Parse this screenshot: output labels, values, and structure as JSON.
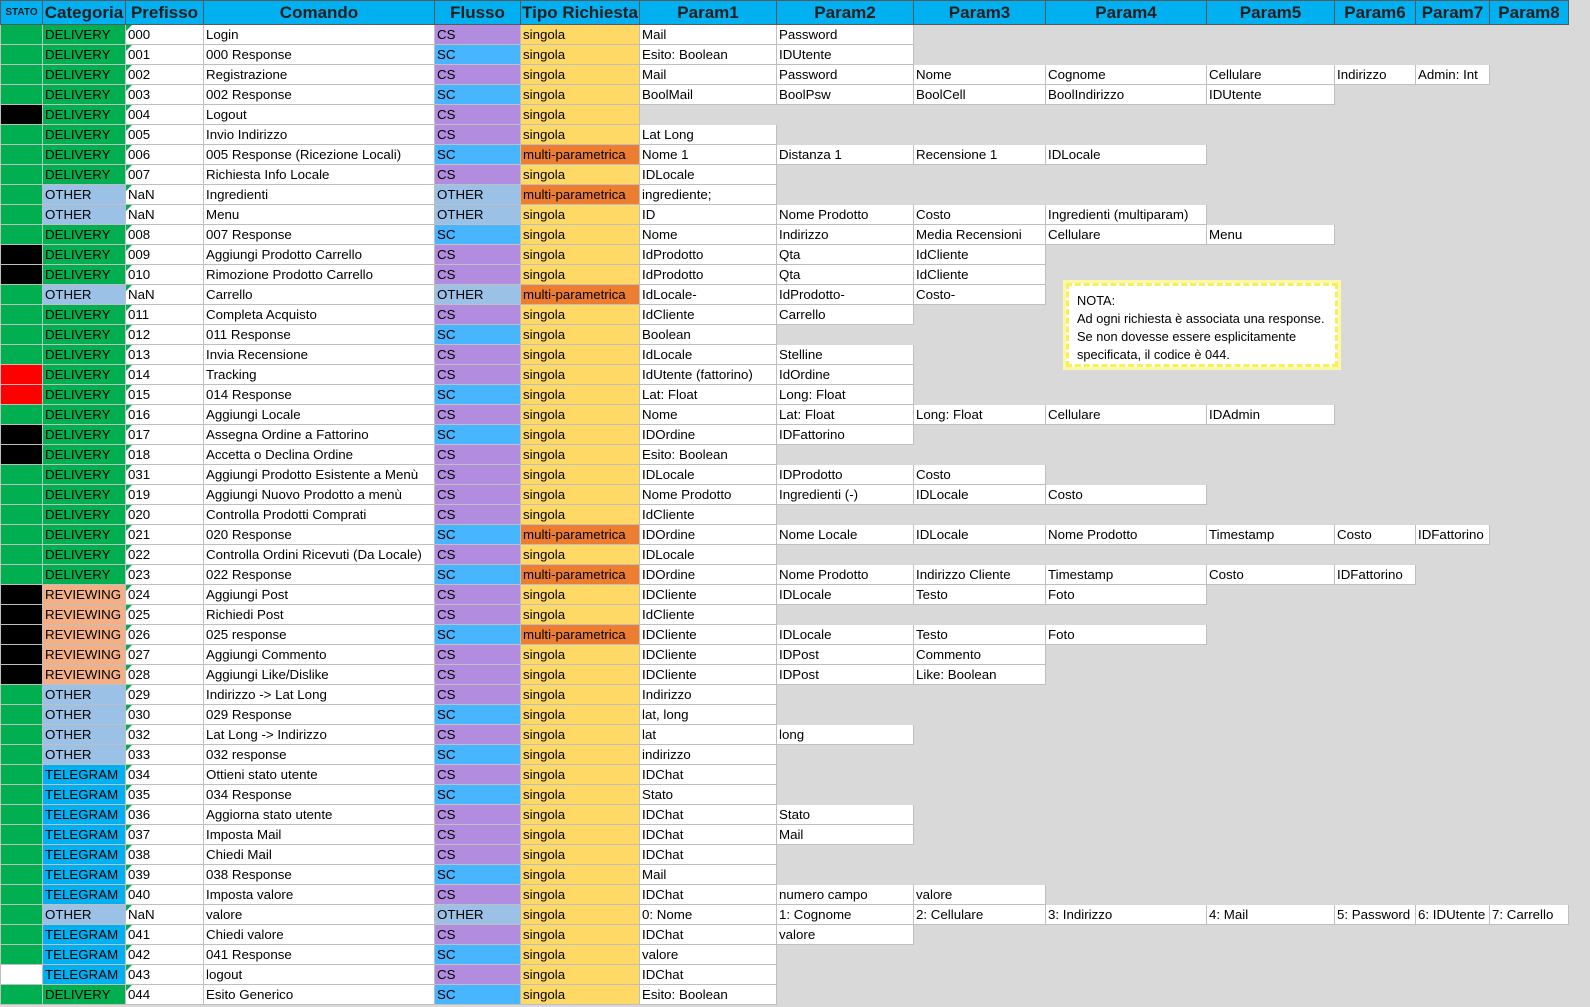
{
  "headers": [
    "STATO",
    "Categoria",
    "Prefisso",
    "Comando",
    "Flusso",
    "Tipo Richiesta",
    "Param1",
    "Param2",
    "Param3",
    "Param4",
    "Param5",
    "Param6",
    "Param7",
    "Param8"
  ],
  "colors": {
    "stato_green": "#00b050",
    "stato_black": "#000000",
    "stato_red": "#ff0000",
    "stato_white": "#ffffff",
    "header_bg": "#00b0f0"
  },
  "note": "NOTA:\nAd ogni richiesta è associata una response.\nSe non dovesse essere esplicitamente specificata, il codice è 044.",
  "rows": [
    {
      "stato": "green",
      "cat": "DELIVERY",
      "pref": "000",
      "cmd": "Login",
      "flusso": "CS",
      "tipo": "singola",
      "params": [
        "Mail",
        "Password"
      ]
    },
    {
      "stato": "green",
      "cat": "DELIVERY",
      "pref": "001",
      "cmd": "000 Response",
      "flusso": "SC",
      "tipo": "singola",
      "params": [
        "Esito: Boolean",
        "IDUtente"
      ]
    },
    {
      "stato": "green",
      "cat": "DELIVERY",
      "pref": "002",
      "cmd": "Registrazione",
      "flusso": "CS",
      "tipo": "singola",
      "params": [
        "Mail",
        "Password",
        "Nome",
        "Cognome",
        "Cellulare",
        "Indirizzo",
        "Admin: Int"
      ]
    },
    {
      "stato": "green",
      "cat": "DELIVERY",
      "pref": "003",
      "cmd": "002 Response",
      "flusso": "SC",
      "tipo": "singola",
      "params": [
        "BoolMail",
        "BoolPsw",
        "BoolCell",
        "BoolIndirizzo",
        "IDUtente"
      ]
    },
    {
      "stato": "black",
      "cat": "DELIVERY",
      "pref": "004",
      "cmd": "Logout",
      "flusso": "CS",
      "tipo": "singola",
      "params": []
    },
    {
      "stato": "green",
      "cat": "DELIVERY",
      "pref": "005",
      "cmd": "Invio Indirizzo",
      "flusso": "CS",
      "tipo": "singola",
      "params": [
        "Lat Long"
      ]
    },
    {
      "stato": "green",
      "cat": "DELIVERY",
      "pref": "006",
      "cmd": "005 Response (Ricezione Locali)",
      "flusso": "SC",
      "tipo": "multi-parametrica",
      "params": [
        " Nome 1",
        "Distanza 1",
        "Recensione 1",
        "IDLocale"
      ]
    },
    {
      "stato": "green",
      "cat": "DELIVERY",
      "pref": "007",
      "cmd": "Richiesta Info Locale",
      "flusso": "CS",
      "tipo": "singola",
      "params": [
        "IDLocale"
      ]
    },
    {
      "stato": "green",
      "cat": "OTHER",
      "pref": "NaN",
      "cmd": "Ingredienti",
      "flusso": "OTHER",
      "tipo": "multi-parametrica",
      "params": [
        "ingrediente;"
      ]
    },
    {
      "stato": "green",
      "cat": "OTHER",
      "pref": "NaN",
      "cmd": "Menu",
      "flusso": "OTHER",
      "tipo": "singola",
      "params": [
        "ID",
        "Nome Prodotto",
        "Costo",
        "Ingredienti (multiparam)"
      ]
    },
    {
      "stato": "green",
      "cat": "DELIVERY",
      "pref": "008",
      "cmd": "007 Response",
      "flusso": "SC",
      "tipo": "singola",
      "params": [
        "Nome",
        "Indirizzo",
        "Media Recensioni",
        "Cellulare",
        "Menu"
      ]
    },
    {
      "stato": "black",
      "cat": "DELIVERY",
      "pref": "009",
      "cmd": "Aggiungi Prodotto Carrello",
      "flusso": "CS",
      "tipo": "singola",
      "params": [
        "IdProdotto",
        "Qta",
        "IdCliente"
      ]
    },
    {
      "stato": "black",
      "cat": "DELIVERY",
      "pref": "010",
      "cmd": "Rimozione Prodotto Carrello",
      "flusso": "CS",
      "tipo": "singola",
      "params": [
        "IdProdotto",
        "Qta",
        "IdCliente"
      ]
    },
    {
      "stato": "green",
      "cat": "OTHER",
      "pref": "NaN",
      "cmd": "Carrello",
      "flusso": "OTHER",
      "tipo": "multi-parametrica",
      "params": [
        "IdLocale-",
        "IdProdotto-",
        "Costo-"
      ]
    },
    {
      "stato": "green",
      "cat": "DELIVERY",
      "pref": "011",
      "cmd": "Completa Acquisto",
      "flusso": "CS",
      "tipo": "singola",
      "params": [
        "IdCliente",
        "Carrello"
      ]
    },
    {
      "stato": "green",
      "cat": "DELIVERY",
      "pref": "012",
      "cmd": "011 Response",
      "flusso": "SC",
      "tipo": "singola",
      "params": [
        "Boolean"
      ]
    },
    {
      "stato": "green",
      "cat": "DELIVERY",
      "pref": "013",
      "cmd": "Invia Recensione",
      "flusso": "CS",
      "tipo": "singola",
      "params": [
        "IdLocale",
        "Stelline"
      ]
    },
    {
      "stato": "red",
      "cat": "DELIVERY",
      "pref": "014",
      "cmd": "Tracking",
      "flusso": "CS",
      "tipo": "singola",
      "params": [
        "IdUtente (fattorino)",
        "IdOrdine"
      ]
    },
    {
      "stato": "red",
      "cat": "DELIVERY",
      "pref": "015",
      "cmd": "014 Response",
      "flusso": "SC",
      "tipo": "singola",
      "params": [
        "Lat: Float",
        "Long: Float"
      ]
    },
    {
      "stato": "green",
      "cat": "DELIVERY",
      "pref": "016",
      "cmd": "Aggiungi Locale",
      "flusso": "CS",
      "tipo": "singola",
      "params": [
        "Nome",
        "Lat: Float",
        "Long: Float",
        "Cellulare",
        "IDAdmin"
      ]
    },
    {
      "stato": "black",
      "cat": "DELIVERY",
      "pref": "017",
      "cmd": "Assegna Ordine a Fattorino",
      "flusso": "SC",
      "tipo": "singola",
      "params": [
        "IDOrdine",
        "IDFattorino"
      ]
    },
    {
      "stato": "black",
      "cat": "DELIVERY",
      "pref": "018",
      "cmd": "Accetta o Declina Ordine",
      "flusso": "CS",
      "tipo": "singola",
      "params": [
        "Esito: Boolean"
      ]
    },
    {
      "stato": "green",
      "cat": "DELIVERY",
      "pref": "031",
      "cmd": "Aggiungi Prodotto Esistente a Menù",
      "flusso": "CS",
      "tipo": "singola",
      "params": [
        "IDLocale",
        "IDProdotto",
        "Costo"
      ]
    },
    {
      "stato": "green",
      "cat": "DELIVERY",
      "pref": "019",
      "cmd": "Aggiungi Nuovo Prodotto a menù",
      "flusso": "CS",
      "tipo": "singola",
      "params": [
        "Nome Prodotto",
        "Ingredienti (-)",
        "IDLocale",
        "Costo"
      ]
    },
    {
      "stato": "green",
      "cat": "DELIVERY",
      "pref": "020",
      "cmd": "Controlla Prodotti Comprati",
      "flusso": "CS",
      "tipo": "singola",
      "params": [
        "IdCliente"
      ]
    },
    {
      "stato": "green",
      "cat": "DELIVERY",
      "pref": "021",
      "cmd": "020 Response",
      "flusso": "SC",
      "tipo": "multi-parametrica",
      "params": [
        "IDOrdine",
        "Nome Locale",
        "IDLocale",
        "Nome Prodotto",
        "Timestamp",
        "Costo",
        "IDFattorino"
      ]
    },
    {
      "stato": "green",
      "cat": "DELIVERY",
      "pref": "022",
      "cmd": "Controlla Ordini Ricevuti (Da Locale)",
      "flusso": "CS",
      "tipo": "singola",
      "params": [
        "IDLocale"
      ]
    },
    {
      "stato": "green",
      "cat": "DELIVERY",
      "pref": "023",
      "cmd": "022 Response",
      "flusso": "SC",
      "tipo": "multi-parametrica",
      "params": [
        "IDOrdine",
        "Nome Prodotto",
        "Indirizzo Cliente",
        "Timestamp",
        "Costo",
        "IDFattorino"
      ]
    },
    {
      "stato": "black",
      "cat": "REVIEWING",
      "pref": "024",
      "cmd": "Aggiungi Post",
      "flusso": "CS",
      "tipo": "singola",
      "params": [
        "IDCliente",
        "IDLocale",
        "Testo",
        "Foto"
      ]
    },
    {
      "stato": "black",
      "cat": "REVIEWING",
      "pref": "025",
      "cmd": "Richiedi Post",
      "flusso": "CS",
      "tipo": "singola",
      "params": [
        "IdCliente"
      ]
    },
    {
      "stato": "black",
      "cat": "REVIEWING",
      "pref": "026",
      "cmd": "025 response",
      "flusso": "SC",
      "tipo": "multi-parametrica",
      "params": [
        "IDCliente",
        "IDLocale",
        "Testo",
        "Foto"
      ]
    },
    {
      "stato": "black",
      "cat": "REVIEWING",
      "pref": "027",
      "cmd": "Aggiungi Commento",
      "flusso": "CS",
      "tipo": "singola",
      "params": [
        "IDCliente",
        "IDPost",
        "Commento"
      ]
    },
    {
      "stato": "black",
      "cat": "REVIEWING",
      "pref": "028",
      "cmd": "Aggiungi Like/Dislike",
      "flusso": "CS",
      "tipo": "singola",
      "params": [
        "IDCliente",
        "IDPost",
        "Like: Boolean"
      ]
    },
    {
      "stato": "green",
      "cat": "OTHER",
      "pref": "029",
      "cmd": "Indirizzo -> Lat Long",
      "flusso": "CS",
      "tipo": "singola",
      "params": [
        "Indirizzo"
      ]
    },
    {
      "stato": "green",
      "cat": "OTHER",
      "pref": "030",
      "cmd": "029 Response",
      "flusso": "SC",
      "tipo": "singola",
      "params": [
        "lat, long"
      ]
    },
    {
      "stato": "green",
      "cat": "OTHER",
      "pref": "032",
      "cmd": "Lat Long -> Indirizzo",
      "flusso": "CS",
      "tipo": "singola",
      "params": [
        "lat",
        "long"
      ]
    },
    {
      "stato": "green",
      "cat": "OTHER",
      "pref": "033",
      "cmd": "032 response",
      "flusso": "SC",
      "tipo": "singola",
      "params": [
        "indirizzo"
      ]
    },
    {
      "stato": "green",
      "cat": "TELEGRAM",
      "pref": "034",
      "cmd": "Ottieni stato utente",
      "flusso": "CS",
      "tipo": "singola",
      "params": [
        "IDChat"
      ]
    },
    {
      "stato": "green",
      "cat": "TELEGRAM",
      "pref": "035",
      "cmd": "034 Response",
      "flusso": "SC",
      "tipo": "singola",
      "params": [
        "Stato"
      ]
    },
    {
      "stato": "green",
      "cat": "TELEGRAM",
      "pref": "036",
      "cmd": "Aggiorna stato utente",
      "flusso": "CS",
      "tipo": "singola",
      "params": [
        "IDChat",
        "Stato"
      ]
    },
    {
      "stato": "green",
      "cat": "TELEGRAM",
      "pref": "037",
      "cmd": "Imposta Mail",
      "flusso": "CS",
      "tipo": "singola",
      "params": [
        "IDChat",
        "Mail"
      ]
    },
    {
      "stato": "green",
      "cat": "TELEGRAM",
      "pref": "038",
      "cmd": "Chiedi Mail",
      "flusso": "CS",
      "tipo": "singola",
      "params": [
        "IDChat"
      ]
    },
    {
      "stato": "green",
      "cat": "TELEGRAM",
      "pref": "039",
      "cmd": "038 Response",
      "flusso": "SC",
      "tipo": "singola",
      "params": [
        "Mail"
      ]
    },
    {
      "stato": "green",
      "cat": "TELEGRAM",
      "pref": "040",
      "cmd": "Imposta valore",
      "flusso": "CS",
      "tipo": "singola",
      "params": [
        "IDChat",
        "numero campo",
        "valore"
      ]
    },
    {
      "stato": "green",
      "cat": "OTHER",
      "pref": "NaN",
      "cmd": "valore",
      "flusso": "OTHER",
      "tipo": "singola",
      "params": [
        "0: Nome",
        "1: Cognome",
        "2: Cellulare",
        "3: Indirizzo",
        "4: Mail",
        "5: Password",
        "6: IDUtente",
        "7: Carrello"
      ]
    },
    {
      "stato": "green",
      "cat": "TELEGRAM",
      "pref": "041",
      "cmd": "Chiedi valore",
      "flusso": "CS",
      "tipo": "singola",
      "params": [
        "IDChat",
        "valore"
      ]
    },
    {
      "stato": "green",
      "cat": "TELEGRAM",
      "pref": "042",
      "cmd": "041 Response",
      "flusso": "SC",
      "tipo": "singola",
      "params": [
        "valore"
      ]
    },
    {
      "stato": "white",
      "cat": "TELEGRAM",
      "pref": "043",
      "cmd": "logout",
      "flusso": "CS",
      "tipo": "singola",
      "params": [
        "IDChat"
      ]
    },
    {
      "stato": "green",
      "cat": "DELIVERY",
      "pref": "044",
      "cmd": "Esito Generico",
      "flusso": "SC",
      "tipo": "singola",
      "params": [
        "Esito: Boolean"
      ]
    }
  ]
}
